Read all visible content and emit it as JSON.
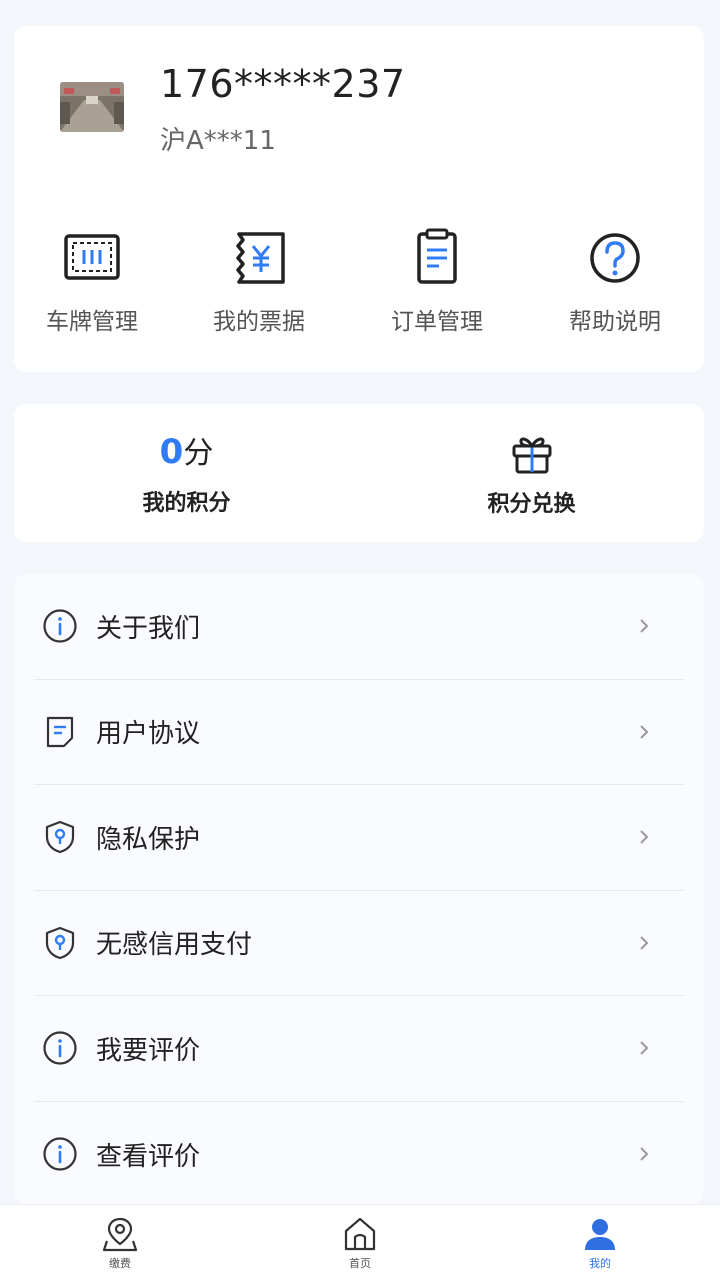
{
  "profile": {
    "phone": "176*****237",
    "plate": "沪A***11"
  },
  "quick_actions": [
    {
      "label": "车牌管理",
      "icon": "license-plate-icon"
    },
    {
      "label": "我的票据",
      "icon": "receipt-icon"
    },
    {
      "label": "订单管理",
      "icon": "order-icon"
    },
    {
      "label": "帮助说明",
      "icon": "help-icon"
    }
  ],
  "points": {
    "value": "0",
    "unit": "分",
    "label": "我的积分",
    "exchange_label": "积分兑换",
    "exchange_icon": "gift-icon"
  },
  "menu": [
    {
      "label": "关于我们",
      "icon": "info-icon"
    },
    {
      "label": "用户协议",
      "icon": "document-icon"
    },
    {
      "label": "隐私保护",
      "icon": "shield-icon"
    },
    {
      "label": "无感信用支付",
      "icon": "shield-icon"
    },
    {
      "label": "我要评价",
      "icon": "info-icon"
    },
    {
      "label": "查看评价",
      "icon": "info-icon"
    }
  ],
  "tabbar": {
    "items": [
      {
        "label": "缴费",
        "icon": "location-icon",
        "active": false
      },
      {
        "label": "首页",
        "icon": "home-icon",
        "active": false
      },
      {
        "label": "我的",
        "icon": "user-icon",
        "active": true
      }
    ]
  },
  "colors": {
    "accent": "#2f7cf6",
    "tab_active": "#2f6fe0",
    "background": "#f3f6fb"
  }
}
